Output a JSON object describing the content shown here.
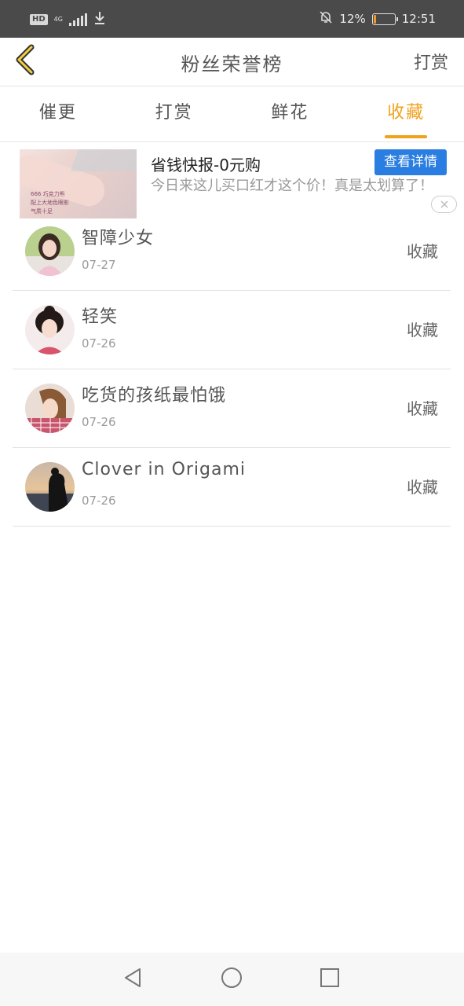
{
  "status_bar": {
    "hd": "HD",
    "network": "4G",
    "battery_text": "12%",
    "time": "12:51",
    "battery_level": 0.12,
    "accent_color": "#f19a24"
  },
  "header": {
    "title": "粉丝荣誉榜",
    "right_label": "打赏"
  },
  "tabs": [
    {
      "label": "催更",
      "active": false
    },
    {
      "label": "打赏",
      "active": false
    },
    {
      "label": "鲜花",
      "active": false
    },
    {
      "label": "收藏",
      "active": true
    }
  ],
  "ad": {
    "title": "省钱快报-0元购",
    "description": "今日来这儿买口红才这个价！真是太划算了！",
    "button": "查看详情",
    "image_caption": [
      "666 巧克力熊",
      "配上大地色眼影",
      "气质十足"
    ]
  },
  "fans": [
    {
      "name": "智障少女",
      "date": "07-27",
      "action": "收藏"
    },
    {
      "name": "轻笑",
      "date": "07-26",
      "action": "收藏"
    },
    {
      "name": "吃货的孩纸最怕饿",
      "date": "07-26",
      "action": "收藏"
    },
    {
      "name": "Clover in Origami",
      "date": "07-26",
      "action": "收藏"
    }
  ],
  "colors": {
    "accent": "#f0a21d",
    "ad_button": "#2a7de1"
  }
}
